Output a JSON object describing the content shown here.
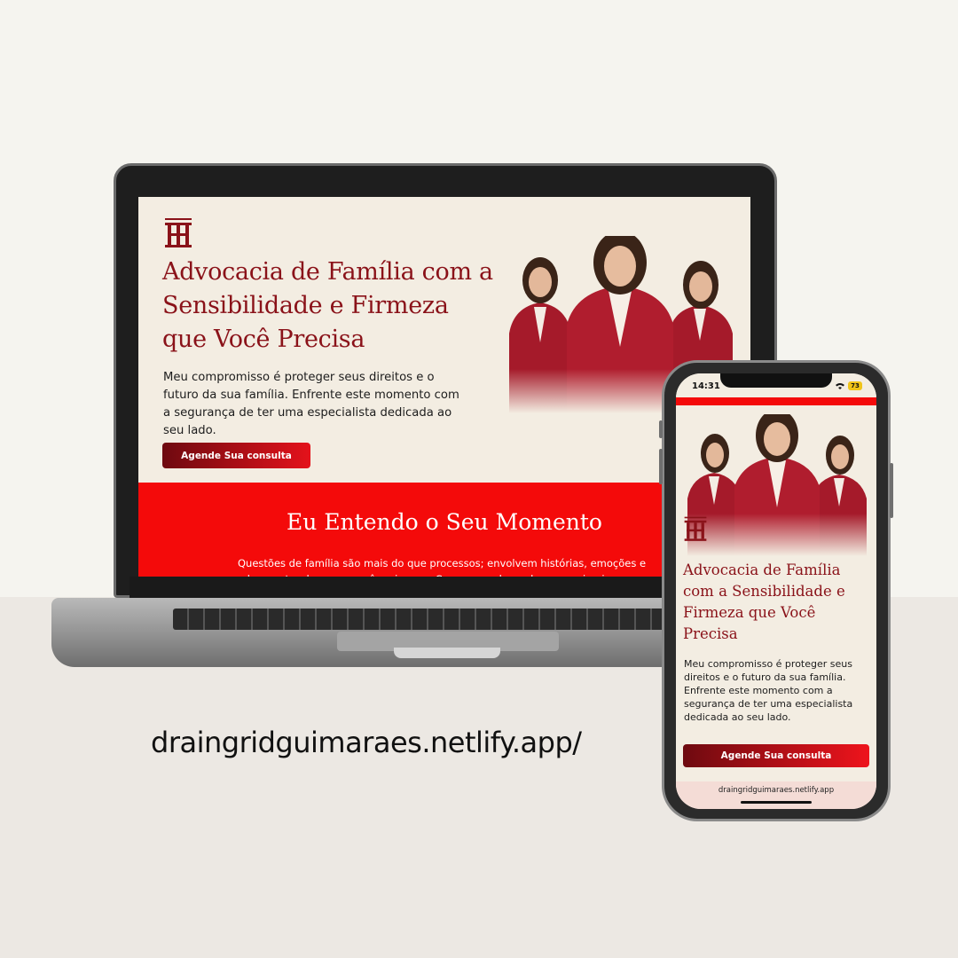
{
  "laptop_site": {
    "logo_icon": "monogram-logo",
    "hero_title": "Advocacia de Família com a Sensibilidade e Firmeza que Você Precisa",
    "hero_subtitle": "Meu compromisso é proteger seus direitos e o futuro da sua família. Enfrente este momento com a segurança de ter uma especialista dedicada ao seu lado.",
    "cta_label": "Agende Sua consulta",
    "section_title": "Eu Entendo o Seu Momento",
    "section_text": "Questões de família são mais do que processos; envolvem histórias, emoções e o bem-estar de quem você mais ama. Como sua advogada, meu primeiro passo é"
  },
  "caption": {
    "url": "draingridguimaraes.netlify.app/"
  },
  "phone_site": {
    "status_time": "14:31",
    "battery_level": "73",
    "hero_title": "Advocacia de Família com a Sensibilidade e Firmeza que Você Precisa",
    "hero_subtitle": "Meu compromisso é proteger seus direitos e o futuro da sua família. Enfrente este momento com a segurança de ter uma especialista dedicada ao seu lado.",
    "cta_label": "Agende Sua consulta",
    "url_bar": "draingridguimaraes.netlify.app"
  },
  "colors": {
    "brand_dark_red": "#8a1219",
    "accent_red": "#f40a0a",
    "cream_background": "#f3ede2"
  }
}
